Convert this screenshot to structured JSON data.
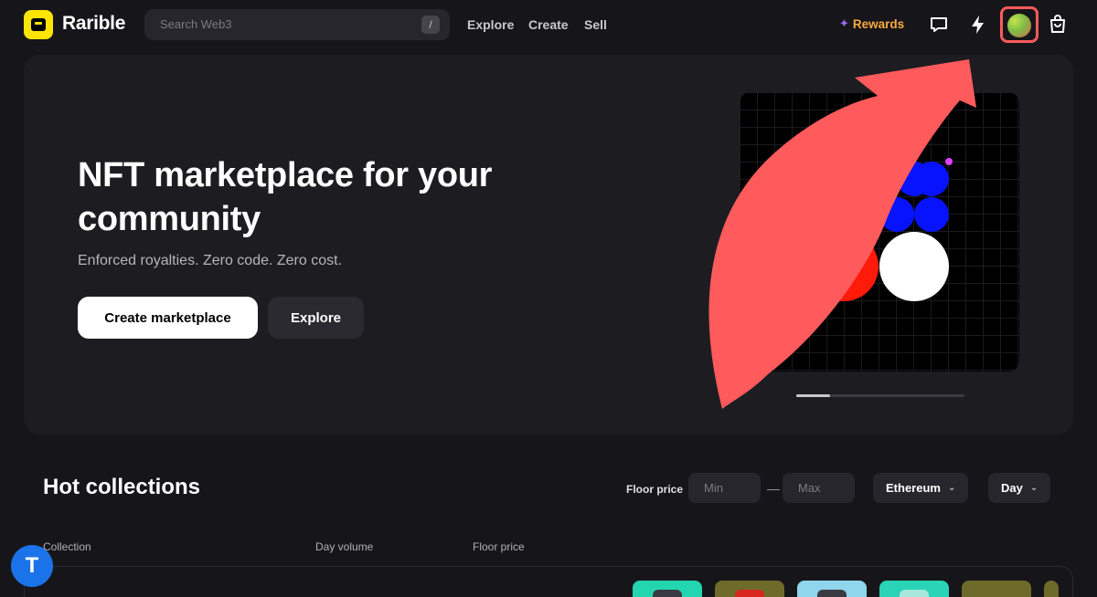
{
  "header": {
    "brand": "Rarible",
    "search_placeholder": "Search Web3",
    "search_shortcut": "/",
    "nav": [
      "Explore",
      "Create",
      "Sell"
    ],
    "rewards": "Rewards",
    "icons": [
      "chat-icon",
      "lightning-icon",
      "cart-icon"
    ]
  },
  "hero": {
    "title": "NFT marketplace for your community",
    "subtitle": "Enforced royalties. Zero code. Zero cost.",
    "primary_button": "Create marketplace",
    "secondary_button": "Explore",
    "carousel_progress": 0.2
  },
  "hot_collections": {
    "title": "Hot collections",
    "floor_price_label": "Floor price",
    "min_placeholder": "Min",
    "max_placeholder": "Max",
    "range_separator": "—",
    "chain": "Ethereum",
    "period": "Day",
    "columns": [
      "Collection",
      "Day volume",
      "Floor price"
    ]
  },
  "colors": {
    "accent_brand": "#fee506",
    "rewards": "#fbaa3e",
    "annotation": "#ff5a5c",
    "help": "#1a73e8"
  }
}
